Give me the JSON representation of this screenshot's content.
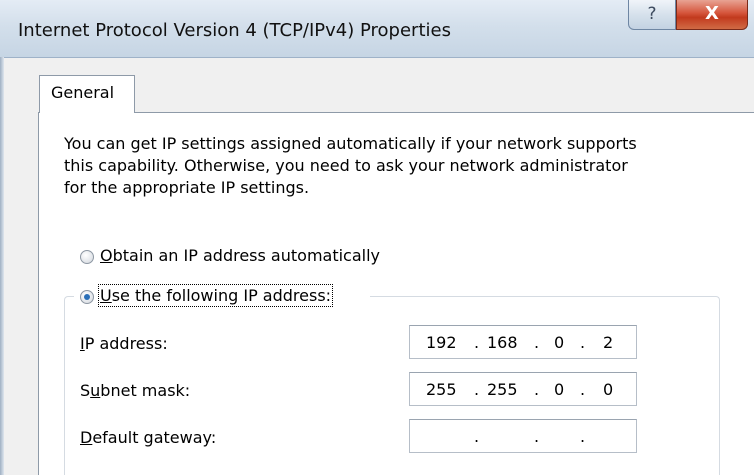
{
  "window": {
    "title": "Internet Protocol Version 4 (TCP/IPv4) Properties",
    "help_label": "?",
    "close_label": "X"
  },
  "tabs": [
    {
      "label": "General",
      "selected": true
    }
  ],
  "description": "You can get IP settings assigned automatically if your network supports\nthis capability. Otherwise, you need to ask your network administrator\nfor the appropriate IP settings.",
  "ip_mode": {
    "auto": {
      "prefix": "",
      "mnemonic": "O",
      "rest": "btain an IP address automatically",
      "checked": false
    },
    "manual": {
      "prefix": "",
      "mnemonic": "U",
      "rest": "se the following IP address:",
      "checked": true
    }
  },
  "fields": {
    "ip_address": {
      "prefix": "",
      "mnemonic": "I",
      "rest": "P address:",
      "octets": [
        "192",
        "168",
        "0",
        "2"
      ]
    },
    "subnet_mask": {
      "prefix": "S",
      "mnemonic": "u",
      "rest": "bnet mask:",
      "octets": [
        "255",
        "255",
        "0",
        "0"
      ]
    },
    "default_gateway": {
      "prefix": "",
      "mnemonic": "D",
      "rest": "efault gateway:",
      "octets": [
        "",
        "",
        "",
        ""
      ]
    }
  },
  "octet_separator": ".",
  "colors": {
    "selected_radio": "#2a6fb8",
    "close_button": "#c23a1e"
  }
}
